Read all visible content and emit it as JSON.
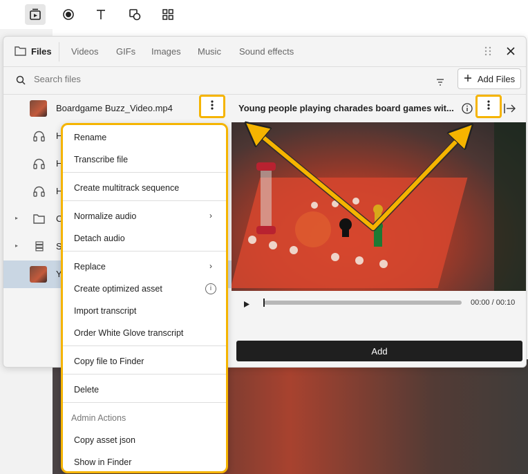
{
  "toolbar": {
    "icons": [
      "media-icon",
      "record-icon",
      "text-icon",
      "shapes-icon",
      "grid-icon"
    ]
  },
  "panel": {
    "tabs": [
      {
        "label": "Files"
      },
      {
        "label": "Videos"
      },
      {
        "label": "GIFs"
      },
      {
        "label": "Images"
      },
      {
        "label": "Music"
      },
      {
        "label": "Sound effects"
      }
    ],
    "search_placeholder": "Search files",
    "add_files_label": "Add Files",
    "files": [
      {
        "name": "Boardgame Buzz_Video.mp4",
        "kind": "video"
      },
      {
        "name": "H",
        "kind": "audio"
      },
      {
        "name": "H",
        "kind": "audio"
      },
      {
        "name": "H",
        "kind": "audio"
      },
      {
        "name": "C",
        "kind": "folder"
      },
      {
        "name": "S",
        "kind": "stack"
      },
      {
        "name": "Y",
        "kind": "video"
      }
    ],
    "preview_title": "Young people playing charades board games wit...",
    "timecode": "00:00 / 00:10",
    "add_label": "Add"
  },
  "menu": {
    "items": [
      "Rename",
      "Transcribe file",
      "Create multitrack sequence",
      "Normalize audio",
      "Detach audio",
      "Replace",
      "Create optimized asset",
      "Import transcript",
      "Order White Glove transcript",
      "Copy file to Finder",
      "Delete",
      "Copy asset json",
      "Show in Finder"
    ],
    "admin_header": "Admin Actions"
  },
  "colors": {
    "highlight": "#f5b400",
    "selected_row": "#c9d6e3",
    "add_button": "#1f1f1f"
  }
}
